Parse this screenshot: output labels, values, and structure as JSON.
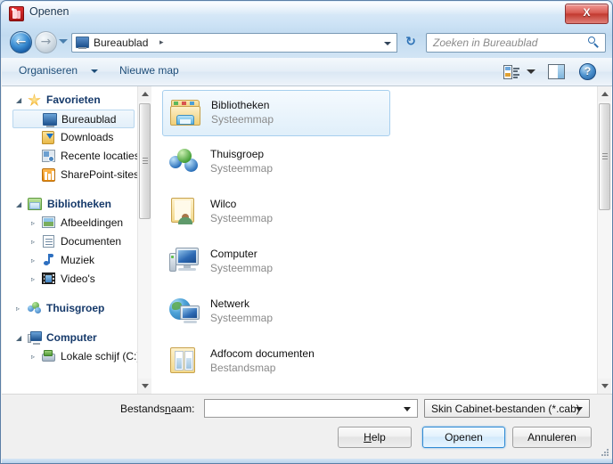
{
  "window": {
    "title": "Openen",
    "app_icon": "app-icon",
    "close_label": "X"
  },
  "nav": {
    "back_glyph": "←",
    "forward_glyph": "→",
    "address_value": "Bureaublad",
    "address_separator": "▸",
    "refresh_glyph": "↻",
    "search_placeholder": "Zoeken in Bureaublad"
  },
  "commandbar": {
    "organize_label": "Organiseren",
    "new_folder_label": "Nieuwe map",
    "help_glyph": "?"
  },
  "sidebar": {
    "groups": [
      {
        "name": "favorieten",
        "header": {
          "label": "Favorieten",
          "expander": "◢",
          "icon": "star-icon"
        },
        "items": [
          {
            "label": "Bureaublad",
            "icon": "desktop-icon",
            "selected": true
          },
          {
            "label": "Downloads",
            "icon": "downloads-icon",
            "selected": false
          },
          {
            "label": "Recente locaties",
            "icon": "recent-locations-icon",
            "selected": false
          },
          {
            "label": "SharePoint-sites",
            "icon": "sharepoint-icon",
            "selected": false
          }
        ]
      },
      {
        "name": "bibliotheken",
        "header": {
          "label": "Bibliotheken",
          "expander": "◢",
          "icon": "library-icon"
        },
        "items": [
          {
            "label": "Afbeeldingen",
            "icon": "pictures-icon",
            "expander": "▹"
          },
          {
            "label": "Documenten",
            "icon": "documents-icon",
            "expander": "▹"
          },
          {
            "label": "Muziek",
            "icon": "music-icon",
            "expander": "▹"
          },
          {
            "label": "Video's",
            "icon": "video-icon",
            "expander": "▹"
          }
        ]
      },
      {
        "name": "thuisgroep",
        "header": {
          "label": "Thuisgroep",
          "expander": "▹",
          "icon": "homegroup-icon"
        },
        "items": []
      },
      {
        "name": "computer",
        "header": {
          "label": "Computer",
          "expander": "◢",
          "icon": "computer-icon"
        },
        "items": [
          {
            "label": "Lokale schijf (C:)",
            "icon": "drive-icon",
            "expander": "▹"
          }
        ]
      }
    ]
  },
  "filelist": {
    "items": [
      {
        "name": "Bibliotheken",
        "type": "Systeemmap",
        "icon": "libraries-folder-icon",
        "selected": true
      },
      {
        "name": "Thuisgroep",
        "type": "Systeemmap",
        "icon": "homegroup-icon",
        "selected": false
      },
      {
        "name": "Wilco",
        "type": "Systeemmap",
        "icon": "user-folder-icon",
        "selected": false
      },
      {
        "name": "Computer",
        "type": "Systeemmap",
        "icon": "computer-icon",
        "selected": false
      },
      {
        "name": "Netwerk",
        "type": "Systeemmap",
        "icon": "network-icon",
        "selected": false
      },
      {
        "name": "Adfocom documenten",
        "type": "Bestandsmap",
        "icon": "documents-folder-icon",
        "selected": false
      }
    ]
  },
  "footer": {
    "filename_label_pre": "Bestands",
    "filename_label_accel": "n",
    "filename_label_post": "aam:",
    "filename_value": "",
    "filetype_value": "Skin Cabinet-bestanden (*.cab)",
    "buttons": {
      "help_pre": "",
      "help_accel": "H",
      "help_post": "elp",
      "open_label": "Openen",
      "cancel_label": "Annuleren"
    }
  },
  "colors": {
    "accent": "#2e8ad4",
    "selection": "#e0effa",
    "close_button": "#c23a30",
    "link_text": "#1f4e79"
  }
}
